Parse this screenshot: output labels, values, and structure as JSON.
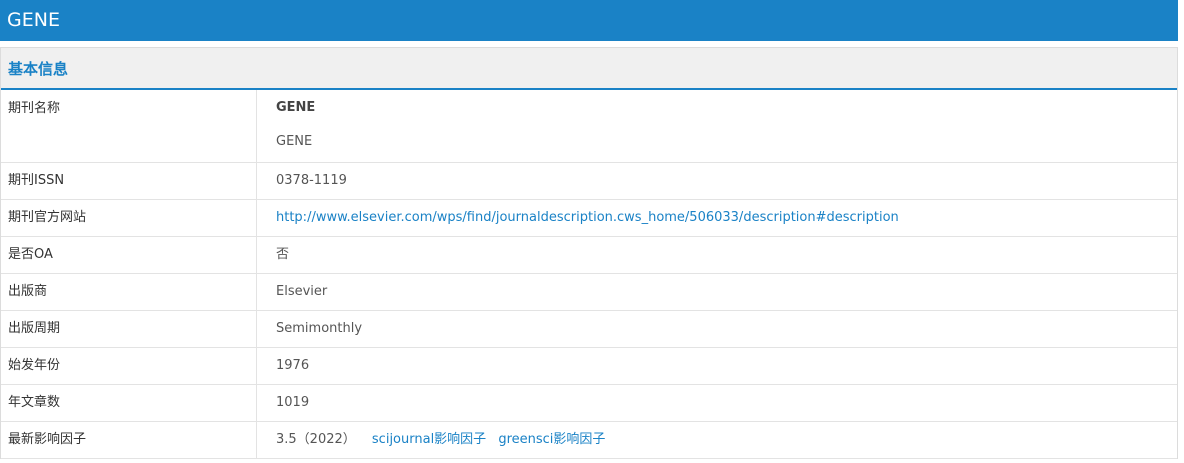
{
  "header": {
    "title": "GENE"
  },
  "section": {
    "title": "基本信息"
  },
  "rows": {
    "name": {
      "label": "期刊名称",
      "primary": "GENE",
      "secondary": "GENE"
    },
    "issn": {
      "label": "期刊ISSN",
      "value": "0378-1119"
    },
    "website": {
      "label": "期刊官方网站",
      "value": "http://www.elsevier.com/wps/find/journaldescription.cws_home/506033/description#description"
    },
    "oa": {
      "label": "是否OA",
      "value": "否"
    },
    "publisher": {
      "label": "出版商",
      "value": "Elsevier"
    },
    "frequency": {
      "label": "出版周期",
      "value": "Semimonthly"
    },
    "start_year": {
      "label": "始发年份",
      "value": "1976"
    },
    "articles": {
      "label": "年文章数",
      "value": "1019"
    },
    "impact": {
      "label": "最新影响因子",
      "value": "3.5（2022）",
      "link1": "scijournal影响因子",
      "link2": "greensci影响因子"
    }
  },
  "colors": {
    "accent": "#1a82c6",
    "section_bg": "#f0f0f0",
    "border": "#e3e3e3"
  }
}
